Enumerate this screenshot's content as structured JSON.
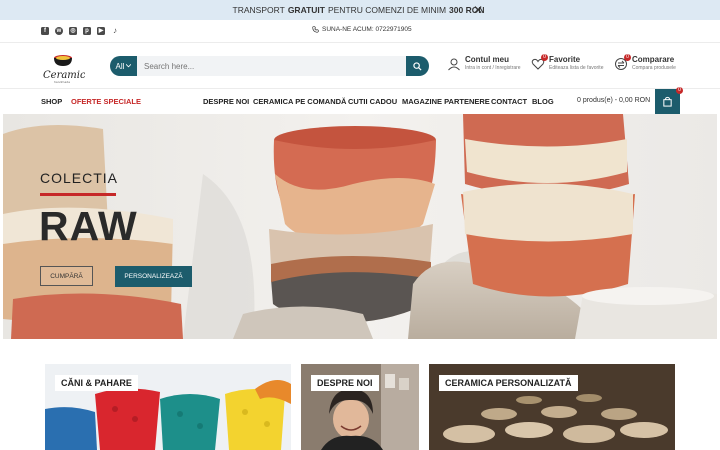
{
  "promo": {
    "text_before": "TRANSPORT",
    "text_bold": "GRATUIT",
    "text_middle": "PENTRU COMENZI DE MINIM",
    "amount": "300 RON",
    "close": "✕"
  },
  "topbar": {
    "socials": [
      "facebook-icon",
      "whatsapp-icon",
      "instagram-icon",
      "pinterest-icon",
      "youtube-icon",
      "tiktok-icon"
    ],
    "phone": "SUNA-NE ACUM: 0722971905"
  },
  "header": {
    "search_scope": "All",
    "search_placeholder": "Search here...",
    "account": {
      "title": "Contul meu",
      "subtitle": "Intra in cont / Inregistrare"
    },
    "favorites": {
      "title": "Favorite",
      "subtitle": "Editeaza lista de favorite",
      "count": "0"
    },
    "compare": {
      "title": "Comparare",
      "subtitle": "Compara produsele",
      "count": "0"
    }
  },
  "nav": {
    "shop": "SHOP",
    "offers": "OFERTE SPECIALE",
    "items": [
      "DESPRE NOI",
      "CERAMICA PE COMANDĂ",
      "CUTII CADOU",
      "MAGAZINE PARTENERE",
      "CONTACT",
      "BLOG"
    ],
    "cart_text": "0 produs(e) - 0,00 RON",
    "cart_count": "0"
  },
  "hero": {
    "subtitle": "COLECTIA",
    "title": "RAW",
    "btn_buy": "CUMPĂRĂ",
    "btn_custom": "PERSONALIZEAZĂ"
  },
  "categories": [
    {
      "label": "CĂNI & PAHARE"
    },
    {
      "label": "DESPRE NOI"
    },
    {
      "label": "CERAMICA PERSONALIZATĂ"
    }
  ],
  "colors": {
    "primary": "#1c5c6c",
    "accent": "#c62828",
    "promo_bg": "#dde9f3"
  }
}
